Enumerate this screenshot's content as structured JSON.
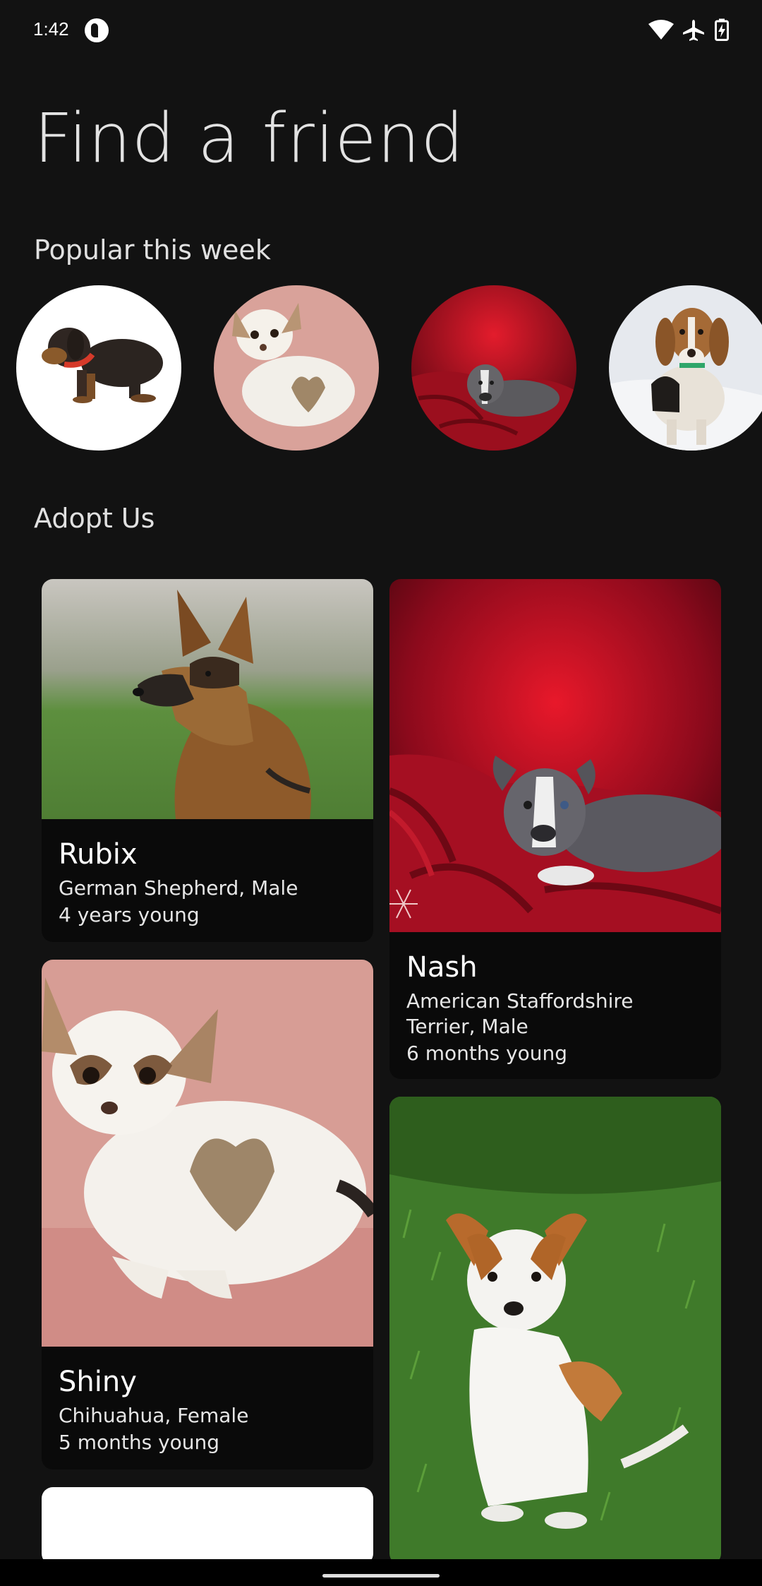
{
  "status_bar": {
    "time": "1:42",
    "icons": [
      "app-notification-icon",
      "wifi-icon",
      "airplane-mode-icon",
      "battery-charging-icon"
    ]
  },
  "title": "Find a friend",
  "popular": {
    "heading": "Popular this week",
    "items": [
      {
        "icon": "dachshund-puppy-photo"
      },
      {
        "icon": "chihuahua-photo"
      },
      {
        "icon": "staffordshire-puppy-photo"
      },
      {
        "icon": "beagle-photo"
      }
    ]
  },
  "adopt": {
    "heading": "Adopt Us",
    "pets": [
      {
        "name": "Rubix",
        "breed": "German Shepherd, Male",
        "age": "4 years young"
      },
      {
        "name": "Nash",
        "breed": "American Staffordshire Terrier, Male",
        "age": "6 months young"
      },
      {
        "name": "Shiny",
        "breed": "Chihuahua, Female",
        "age": "5 months young"
      }
    ]
  },
  "colors": {
    "background": "#121212",
    "card": "#0a0a0a",
    "text": "#e2e2e2"
  }
}
